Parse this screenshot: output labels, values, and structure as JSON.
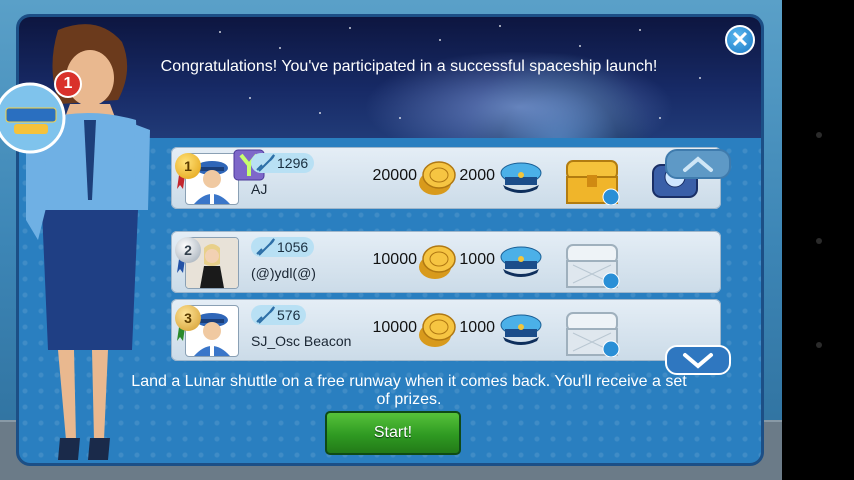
{
  "dialog": {
    "message": "Congratulations! You've participated in a successful spaceship launch!",
    "close_icon": "close-icon",
    "instructions": "Land a Lunar shuttle on a free runway when it comes back. You'll receive a set of prizes.",
    "start_label": "Start!"
  },
  "notification": {
    "count": "1"
  },
  "leaderboard": [
    {
      "rank": "1",
      "rockets": "1296",
      "name": "AJ",
      "coins": "20000",
      "caps": "2000",
      "chest": "gold",
      "extra_prize": "space-helmet-case"
    },
    {
      "rank": "2",
      "rockets": "1056",
      "name": "(@)ydl(@)",
      "coins": "10000",
      "caps": "1000",
      "chest": "silver"
    },
    {
      "rank": "3",
      "rockets": "576",
      "name": "SJ_Osc Beacon",
      "coins": "10000",
      "caps": "1000",
      "chest": "silver"
    }
  ],
  "colors": {
    "gold": "#f2b51a",
    "silver": "#c9d2da",
    "bronze": "#d8a33a",
    "start_green": "#2f9a22",
    "panel_blue": "#2a7fc0"
  }
}
